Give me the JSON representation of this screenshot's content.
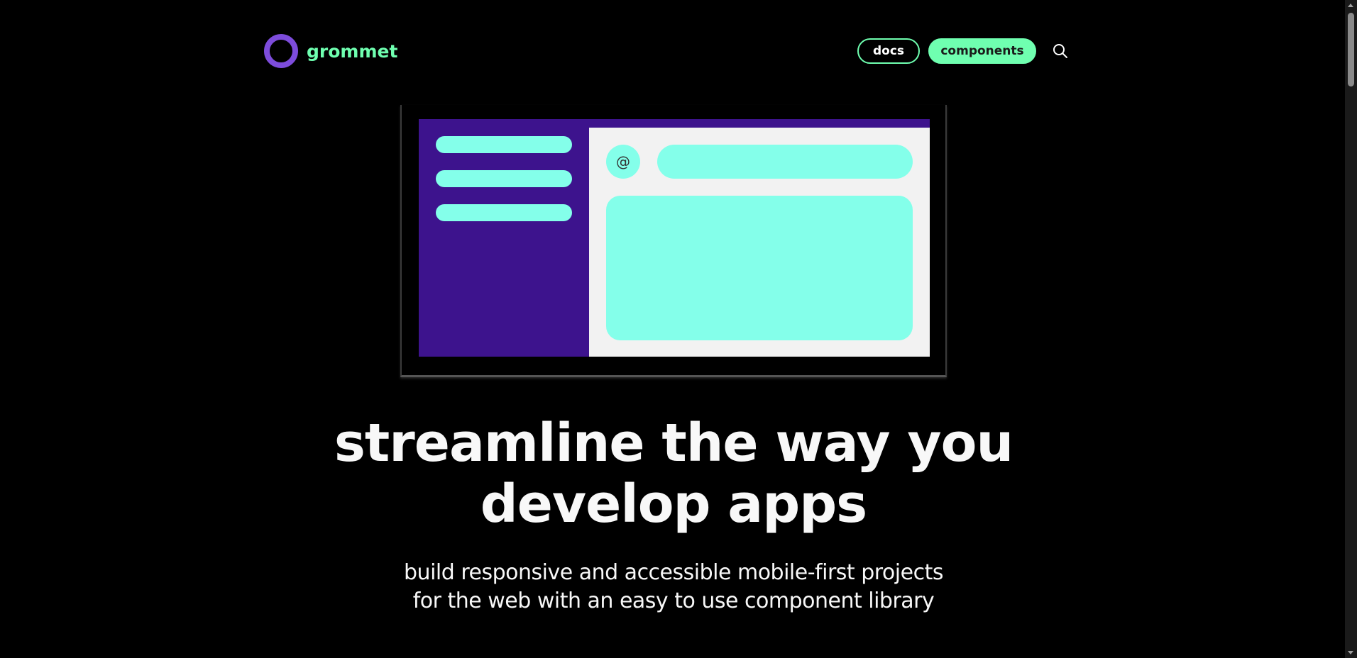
{
  "header": {
    "logo_text": "grommet",
    "nav": {
      "docs_label": "docs",
      "components_label": "components"
    },
    "search_icon": "search-icon"
  },
  "hero": {
    "illustration": {
      "avatar_symbol": "@",
      "colors": {
        "sidebar": "#3D138D",
        "accent": "#84FFEA",
        "content_bg": "#F2F2F2"
      }
    },
    "headline_line1": "streamline the way you",
    "headline_line2": "develop apps",
    "subline_line1": "build responsive and accessible mobile-first projects",
    "subline_line2": "for the web with an easy to use component library"
  },
  "colors": {
    "background": "#000000",
    "brand": "#7D4CDB",
    "accent": "#6FFFB0",
    "text": "#F8F8F8"
  }
}
